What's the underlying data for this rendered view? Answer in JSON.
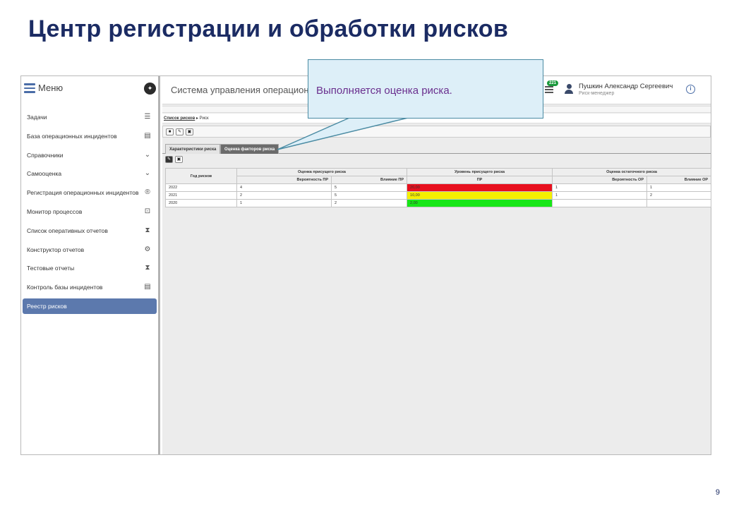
{
  "slide": {
    "title": "Центр регистрации и обработки рисков",
    "page_number": "9"
  },
  "sidebar": {
    "menu_title": "Меню",
    "items": [
      {
        "label": "Задачи",
        "icon": "checklist-icon",
        "glyph": "☰"
      },
      {
        "label": "База операционных инцидентов",
        "icon": "database-icon",
        "glyph": "▤"
      },
      {
        "label": "Справочники",
        "icon": "chevron-down-icon",
        "glyph": "⌄"
      },
      {
        "label": "Самооценка",
        "icon": "chevron-down-icon",
        "glyph": "⌄"
      },
      {
        "label": "Регистрация операционных инцидентов",
        "icon": "registered-icon",
        "glyph": "®"
      },
      {
        "label": "Монитор процессов",
        "icon": "monitor-icon",
        "glyph": "⊡"
      },
      {
        "label": "Список оперативных отчетов",
        "icon": "hourglass-icon",
        "glyph": "⧗"
      },
      {
        "label": "Конструктор отчетов",
        "icon": "gears-icon",
        "glyph": "⚙"
      },
      {
        "label": "Тестовые отчеты",
        "icon": "hourglass-icon",
        "glyph": "⧗"
      },
      {
        "label": "Контроль базы инцидентов",
        "icon": "database-icon",
        "glyph": "▤"
      },
      {
        "label": "Реестр рисков",
        "icon": "",
        "glyph": ""
      }
    ]
  },
  "topbar": {
    "app_title": "Система управления операционн",
    "notification_count": "221",
    "user_name": "Пушкин Александр Сергеевич",
    "user_role": "Риск-менеджер"
  },
  "breadcrumb": {
    "link": "Список рисков",
    "separator": "▸",
    "current": "Риск"
  },
  "tabs": [
    {
      "label": "Характеристики риска",
      "active": false
    },
    {
      "label": "Оценка факторов риска",
      "active": true
    }
  ],
  "table": {
    "year_header": "Год рисков",
    "group_headers": [
      "Оценка присущего риска",
      "Уровень присущего риска",
      "Оценка остаточного риска"
    ],
    "sub_headers": [
      "Вероятность ПР",
      "Влияние ПР",
      "ПР",
      "Вероятность ОР",
      "Влияние ОР"
    ],
    "rows": [
      {
        "year": "2022",
        "prob_pr": "4",
        "impact_pr": "5",
        "pr": "20,00",
        "pr_color": "#e8101e",
        "prob_or": "1",
        "impact_or": "1"
      },
      {
        "year": "2021",
        "prob_pr": "2",
        "impact_pr": "5",
        "pr": "10,00",
        "pr_color": "#f5f000",
        "prob_or": "1",
        "impact_or": "2"
      },
      {
        "year": "2020",
        "prob_pr": "1",
        "impact_pr": "2",
        "pr": "2,00",
        "pr_color": "#17e617",
        "prob_or": "",
        "impact_or": ""
      }
    ]
  },
  "callout": {
    "text": "Выполняется оценка риска."
  },
  "colors": {
    "title": "#1b2b63",
    "active_menu": "#5c79ad",
    "callout_bg": "#ddeff8",
    "callout_text": "#6a2f8e"
  }
}
